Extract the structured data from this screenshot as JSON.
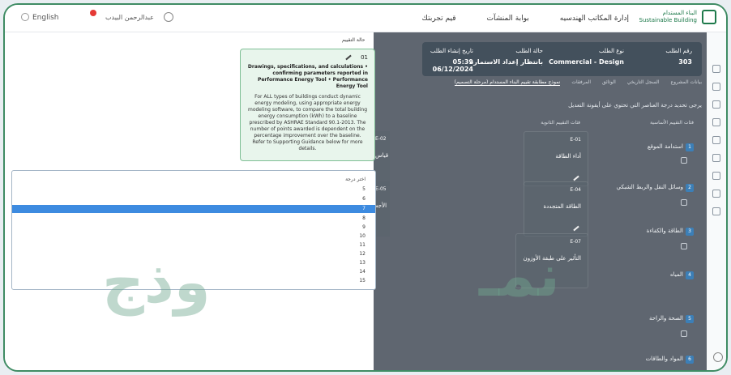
{
  "topbar": {
    "language": "English",
    "user_name": "عبدالرحمن البيدب",
    "nav": [
      "إدارة المكاتب الهندسيه",
      "بوابة المنشآت",
      "قيم تجربتك"
    ],
    "logo_text": [
      "البناء المستدام",
      "Sustainable Building"
    ]
  },
  "request": {
    "fields": [
      {
        "label": "رقم الطلب",
        "value": "303"
      },
      {
        "label": "نوع الطلب",
        "value": "Commercial - Design"
      },
      {
        "label": "حالة الطلب",
        "value": "بانتظار إعداد الاستمارة"
      },
      {
        "label": "تاريخ إنشاء الطلب",
        "value": "05:39 06/12/2024"
      }
    ],
    "tabs": [
      "بيانات المشروع",
      "السجل التاريخي",
      "الوثائق",
      "المرفقات",
      "نموذج مطابقة تقييم البناء المستدام (مرحلة التصميم)"
    ],
    "intro": "يرجى تحديد درجة العناصر التي تحتوي على أيقونة التعديل",
    "col_main": "فئات التقييم الأساسية",
    "col_sub": "فئات التقييم الثانوية",
    "eval_status": "حالة التقييم"
  },
  "categories": [
    {
      "n": "1",
      "label": "استدامة الموقع"
    },
    {
      "n": "2",
      "label": "وسائل النقل والربط الشبكي"
    },
    {
      "n": "3",
      "label": "الطاقة والكفاءة"
    },
    {
      "n": "4",
      "label": "المياه"
    },
    {
      "n": "5",
      "label": "الصحة والراحة"
    },
    {
      "n": "6",
      "label": "المواد والطاقات"
    }
  ],
  "subcategories": [
    {
      "code": "E-01",
      "name": "أداء الطاقة"
    },
    {
      "code": "E-04",
      "name": "الطاقة المتجددة"
    },
    {
      "code": "E-07",
      "name": "التأثير على طبقة الأوزون"
    }
  ],
  "partial_subcategories": [
    {
      "code": "E-02",
      "name": "قياس"
    },
    {
      "code": "E-05",
      "name": "الأجه"
    }
  ],
  "tooltip": {
    "number": "01",
    "title": "Drawings, specifications, and calculations • confirming parameters reported in Performance Energy Tool • Performance Energy Tool",
    "description": "For ALL types of buildings conduct dynamic energy modeling, using appropriate energy modeling software, to compare the total building energy consumption (kWh) to a baseline prescribed by ASHRAE Standard 90.1-2013. The number of points awarded is dependent on the percentage improvement over the baseline. Refer to Supporting Guidance below for more details."
  },
  "select": {
    "placeholder": "اختر درجة",
    "options": [
      "5",
      "6",
      "7",
      "8",
      "9",
      "10",
      "11",
      "12",
      "13",
      "14",
      "15"
    ],
    "selected": "7"
  },
  "watermark": {
    "left": "وذج",
    "right": "نمـ"
  }
}
